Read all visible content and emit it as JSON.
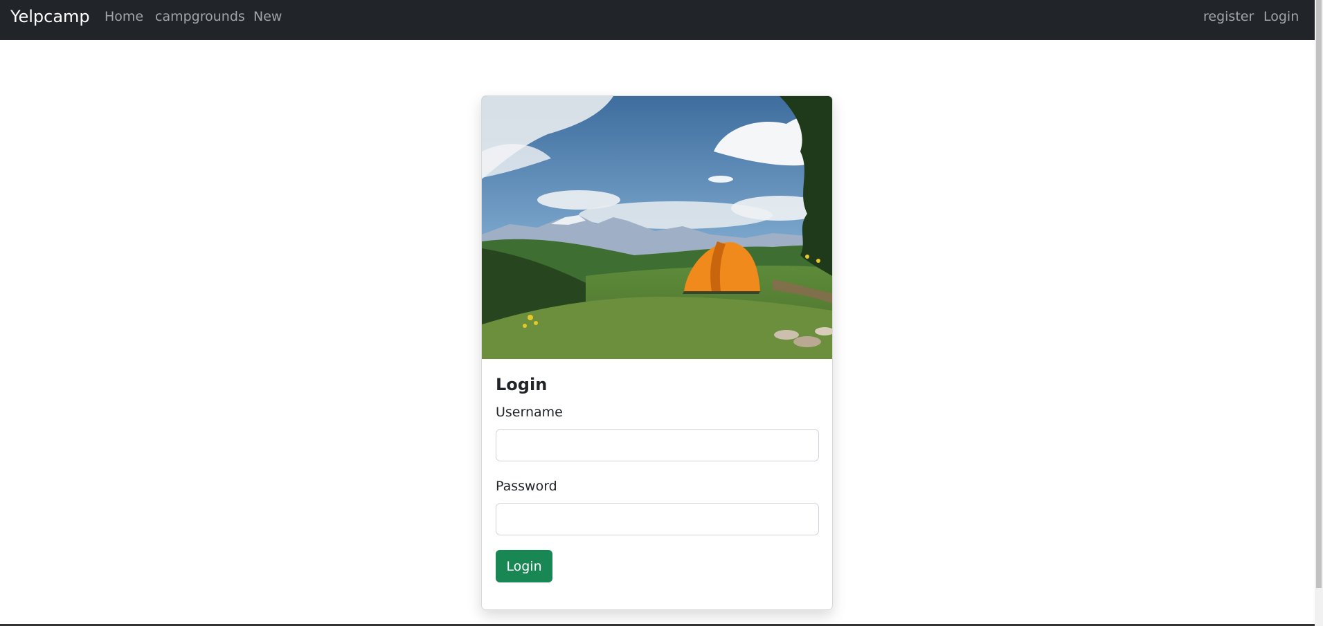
{
  "navbar": {
    "brand": "Yelpcamp",
    "links": [
      "Home",
      "campgrounds",
      "New"
    ],
    "right_links": [
      "register",
      "Login"
    ]
  },
  "card": {
    "image_icon": "campground-photo",
    "title": "Login",
    "username_label": "Username",
    "username_value": "",
    "password_label": "Password",
    "password_value": "",
    "submit_label": "Login"
  },
  "colors": {
    "navbar_bg": "#212529",
    "button_bg": "#198754",
    "tent": "#f08a1c"
  }
}
